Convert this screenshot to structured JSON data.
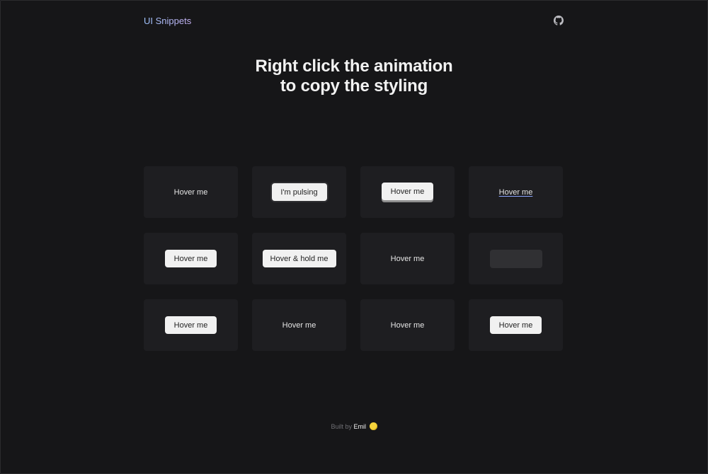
{
  "header": {
    "brand": "UI Snippets",
    "github_icon": "github-icon"
  },
  "hero": {
    "line1": "Right click the animation",
    "line2": "to copy the styling"
  },
  "cards": [
    {
      "label": "Hover me"
    },
    {
      "label": "I'm pulsing"
    },
    {
      "label": "Hover me"
    },
    {
      "label": "Hover me"
    },
    {
      "label": "Hover me"
    },
    {
      "label": "Hover & hold me"
    },
    {
      "label": "Hover me"
    },
    {
      "label": ""
    },
    {
      "label": "Hover me"
    },
    {
      "label": "Hover me"
    },
    {
      "label": "Hover me"
    },
    {
      "label": "Hover me"
    }
  ],
  "footer": {
    "prefix": "Built by",
    "author": "Emil",
    "emoji_icon": "smiley-icon"
  },
  "colors": {
    "background": "#161618",
    "card": "#1e1e21",
    "button": "#f1f1f1",
    "brand_gradient_start": "#9fc4ff",
    "brand_gradient_end": "#c8b4f5"
  }
}
